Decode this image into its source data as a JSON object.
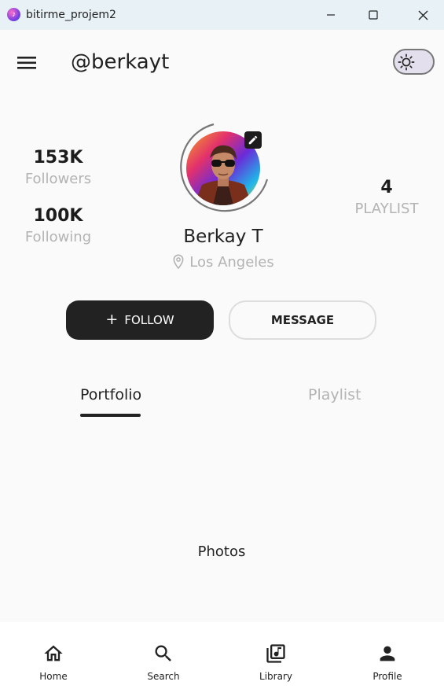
{
  "window": {
    "title": "bitirme_projem2",
    "controls": {
      "minimize_icon": "minimize-icon",
      "maximize_icon": "maximize-icon",
      "close_icon": "close-icon"
    }
  },
  "header": {
    "menu_icon": "hamburger-menu-icon",
    "username": "@berkayt",
    "theme_toggle_icon": "sun-icon"
  },
  "profile": {
    "name": "Berkay T",
    "location": "Los Angeles",
    "location_icon": "location-pin-icon",
    "edit_icon": "edit-pencil-icon"
  },
  "stats": {
    "followers": {
      "value": "153K",
      "label": "Followers"
    },
    "following": {
      "value": "100K",
      "label": "Following"
    },
    "playlist": {
      "value": "4",
      "label": "PLAYLIST"
    }
  },
  "actions": {
    "follow_icon": "+",
    "follow_label": "FOLLOW",
    "message_label": "MESSAGE"
  },
  "tabs": [
    {
      "label": "Portfolio",
      "active": true
    },
    {
      "label": "Playlist",
      "active": false
    }
  ],
  "content": {
    "placeholder": "Photos"
  },
  "bottom_nav": [
    {
      "label": "Home",
      "icon": "home-icon"
    },
    {
      "label": "Search",
      "icon": "search-icon"
    },
    {
      "label": "Library",
      "icon": "library-music-icon"
    },
    {
      "label": "Profile",
      "icon": "person-icon"
    }
  ],
  "colors": {
    "background": "#fafafa",
    "titlebar": "#e8f1f5",
    "primary_dark": "#222222",
    "muted_text": "#b3b3b3",
    "toggle_bg": "#e4dfec"
  }
}
